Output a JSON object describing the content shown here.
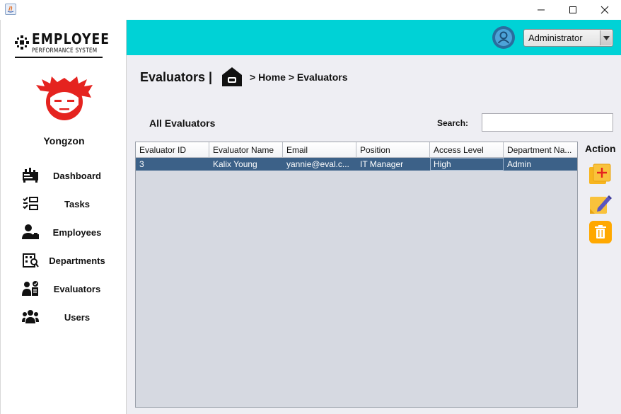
{
  "window": {
    "controls": {
      "minimize": "minimize-icon",
      "maximize": "maximize-icon",
      "close": "close-icon"
    }
  },
  "sidebar": {
    "logo": {
      "title": "EMPLOYEE",
      "subtitle": "PERFORMANCE SYSTEM"
    },
    "username": "Yongzon",
    "items": [
      {
        "label": "Dashboard",
        "icon": "dashboard-icon"
      },
      {
        "label": "Tasks",
        "icon": "tasks-icon"
      },
      {
        "label": "Employees",
        "icon": "employees-icon"
      },
      {
        "label": "Departments",
        "icon": "departments-icon"
      },
      {
        "label": "Evaluators",
        "icon": "evaluators-icon"
      },
      {
        "label": "Users",
        "icon": "users-icon"
      }
    ]
  },
  "header": {
    "role": "Administrator",
    "accent_color": "#00d2d6"
  },
  "main": {
    "title": "Evaluators |",
    "breadcrumb": "> Home > Evaluators",
    "section_title": "All Evaluators",
    "search": {
      "label": "Search:",
      "value": ""
    },
    "table": {
      "columns": [
        "Evaluator ID",
        "Evaluator Name",
        "Email",
        "Position",
        "Access Level",
        "Department Na..."
      ],
      "rows": [
        [
          "3",
          "Kalix Young",
          "yannie@eval.c...",
          "IT Manager",
          "High",
          "Admin"
        ]
      ],
      "selected_row_color": "#3c6188"
    },
    "actions": {
      "label": "Action",
      "buttons": [
        {
          "name": "add",
          "icon": "add-icon"
        },
        {
          "name": "edit",
          "icon": "edit-icon"
        },
        {
          "name": "delete",
          "icon": "delete-icon"
        }
      ]
    }
  }
}
